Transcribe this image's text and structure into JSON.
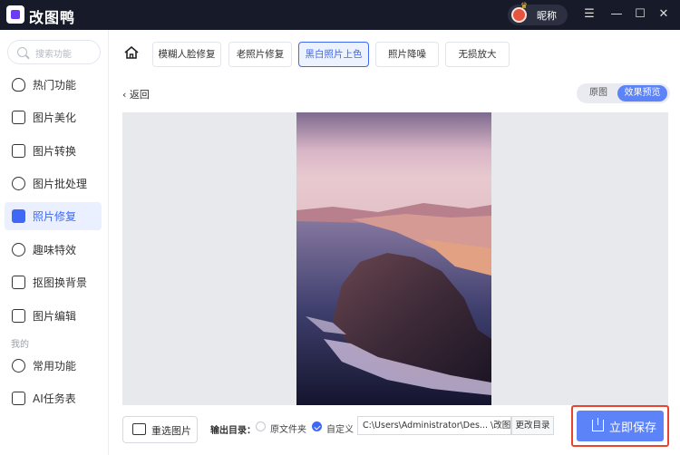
{
  "app": {
    "title": "改图鸭",
    "user_nickname": "昵称"
  },
  "window_controls": {
    "menu": "☰",
    "minimize": "—",
    "maximize": "☐",
    "close": "✕"
  },
  "sidebar": {
    "search_placeholder": "搜索功能",
    "items": [
      {
        "label": "热门功能",
        "icon": "fire-icon"
      },
      {
        "label": "图片美化",
        "icon": "image-beautify-icon"
      },
      {
        "label": "图片转换",
        "icon": "image-convert-icon"
      },
      {
        "label": "图片批处理",
        "icon": "batch-icon"
      },
      {
        "label": "照片修复",
        "icon": "photo-repair-icon",
        "active": true
      },
      {
        "label": "趣味特效",
        "icon": "sparkle-icon"
      },
      {
        "label": "抠图换背景",
        "icon": "cutout-icon"
      },
      {
        "label": "图片编辑",
        "icon": "image-edit-icon"
      }
    ],
    "section_label": "我的",
    "my_items": [
      {
        "label": "常用功能",
        "icon": "grid-icon"
      },
      {
        "label": "AI任务表",
        "icon": "task-list-icon"
      }
    ]
  },
  "tabs": [
    {
      "label": "模糊人脸修复"
    },
    {
      "label": "老照片修复"
    },
    {
      "label": "黑白照片上色",
      "active": true
    },
    {
      "label": "照片降噪"
    },
    {
      "label": "无损放大"
    }
  ],
  "toolbar": {
    "back_label": "返回",
    "view_original": "原图",
    "view_preview": "效果预览"
  },
  "bottom": {
    "reselect_label": "重选图片",
    "output_label": "输出目录：",
    "option_original": "原文件夹",
    "option_custom": "自定义",
    "selected_option": "自定义",
    "path_value": "C:\\Users\\Administrator\\Des... \\改图鸭",
    "change_dir_label": "更改目录",
    "save_label": "立即保存"
  },
  "colors": {
    "accent": "#3e68f5",
    "save_button": "#5d83f8",
    "highlight_border": "#e8452f",
    "titlebar": "#161a29"
  }
}
